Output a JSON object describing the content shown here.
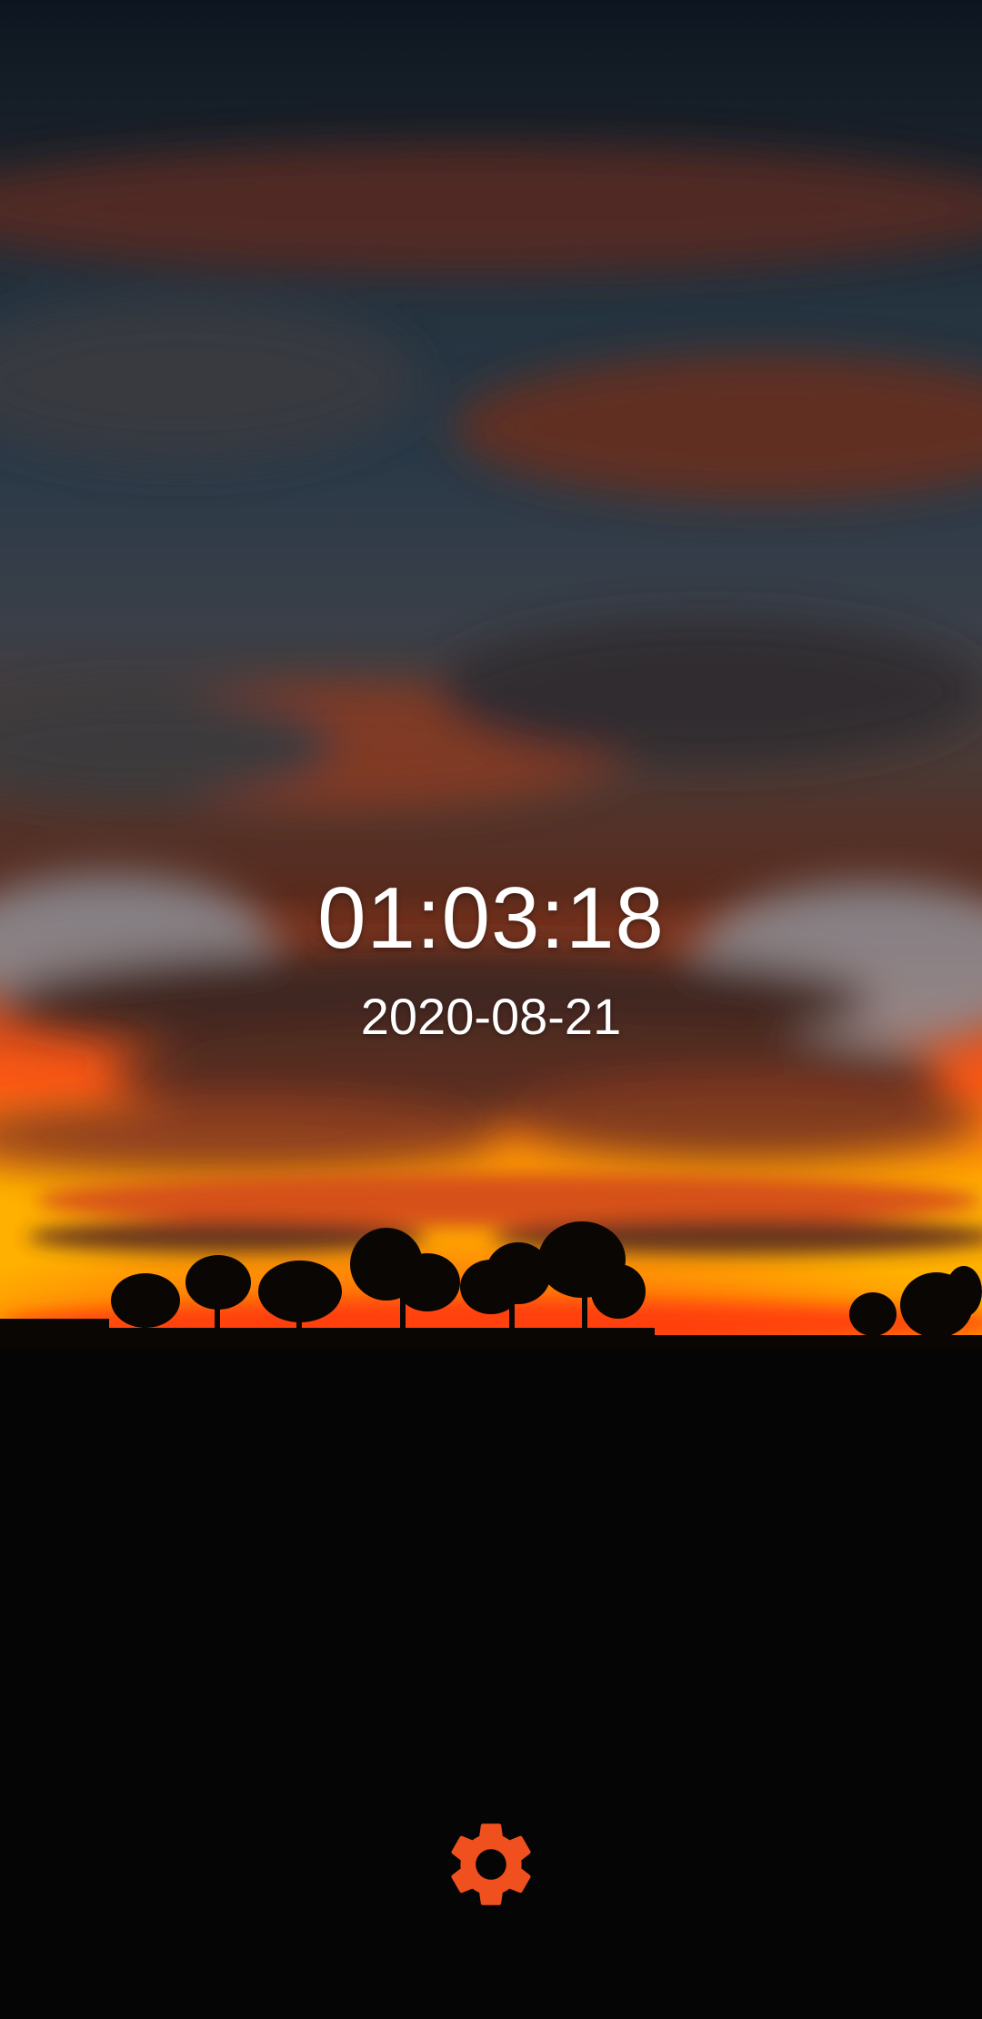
{
  "clock": {
    "time": "01:03:18",
    "date": "2020-08-21"
  },
  "settings": {
    "icon": "gear-icon"
  },
  "colors": {
    "accent": "#F0501E",
    "text": "#FFFFFF",
    "ground": "#050505",
    "sky_top": "#0D1620",
    "horizon_glow": "#FF4A12"
  }
}
